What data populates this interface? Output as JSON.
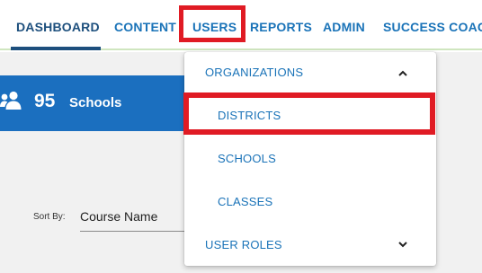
{
  "nav": {
    "items": [
      "DASHBOARD",
      "CONTENT",
      "USERS",
      "REPORTS",
      "ADMIN",
      "SUCCESS COACH"
    ]
  },
  "stats": {
    "count": "95",
    "label": "Schools",
    "icon": "people-icon"
  },
  "sort": {
    "label": "Sort By:",
    "value": "Course Name"
  },
  "dropdown": {
    "organizations": "ORGANIZATIONS",
    "districts": "DISTRICTS",
    "schools": "SCHOOLS",
    "classes": "CLASSES",
    "user_roles": "USER ROLES"
  },
  "colors": {
    "accent": "#1a73b8",
    "nav_active": "#1d4f7d",
    "card": "#1b6fbf",
    "highlight": "#e01b24"
  }
}
